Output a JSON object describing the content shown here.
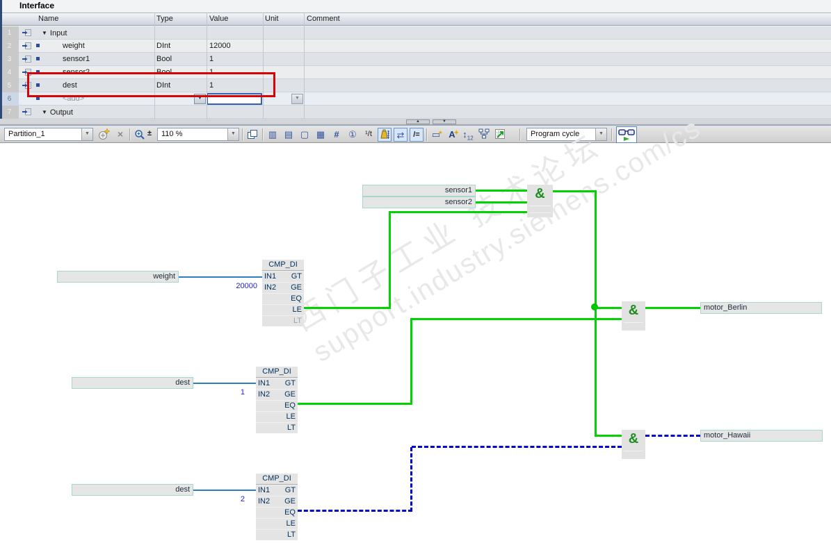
{
  "interface_panel": {
    "title": "Interface",
    "columns": {
      "name": "Name",
      "type": "Type",
      "value": "Value",
      "unit": "Unit",
      "comment": "Comment"
    },
    "rows": [
      {
        "num": "1",
        "name": "Input",
        "type": "",
        "value": ""
      },
      {
        "num": "2",
        "name": "weight",
        "type": "DInt",
        "value": "12000"
      },
      {
        "num": "3",
        "name": "sensor1",
        "type": "Bool",
        "value": "1"
      },
      {
        "num": "4",
        "name": "sensor2",
        "type": "Bool",
        "value": "1"
      },
      {
        "num": "5",
        "name": "dest",
        "type": "DInt",
        "value": "1"
      },
      {
        "num": "6",
        "name": "<add>",
        "type": "",
        "value": ""
      },
      {
        "num": "7",
        "name": "Output",
        "type": "",
        "value": ""
      }
    ]
  },
  "splitter": {
    "up": "▲",
    "down": "▼"
  },
  "toolbar": {
    "partition_value": "Partition_1",
    "zoom_value": "110 %",
    "network_value": "Program cycle",
    "plusminus": "±"
  },
  "fbd": {
    "and_label": "&",
    "operands": {
      "sensor1": "sensor1",
      "sensor2": "sensor2",
      "weight": "weight",
      "dest": "dest",
      "motor_berlin": "motor_Berlin",
      "motor_hawaii": "motor_Hawaii"
    },
    "cmp": {
      "title": "CMP_DI",
      "in1": "IN1",
      "in2": "IN2",
      "gt": "GT",
      "ge": "GE",
      "eq": "EQ",
      "le": "LE",
      "lt": "LT"
    },
    "constants": {
      "cmp1_in2": "20000",
      "cmp2_in2": "1",
      "cmp3_in2": "2"
    },
    "watermark": {
      "line1": "西门子工业 技术论坛",
      "line2": "support.industry.siemens.com/cs"
    }
  },
  "colors": {
    "wire_true_green": "#00d300",
    "wire_false_blue": "#0000c8",
    "operand_wire_blue": "#2b7fbe",
    "highlight_red": "#d60404",
    "gate_green": "#1e8c1e",
    "port_text_navy": "#00305a",
    "constant_blue": "#1f1fc8"
  }
}
